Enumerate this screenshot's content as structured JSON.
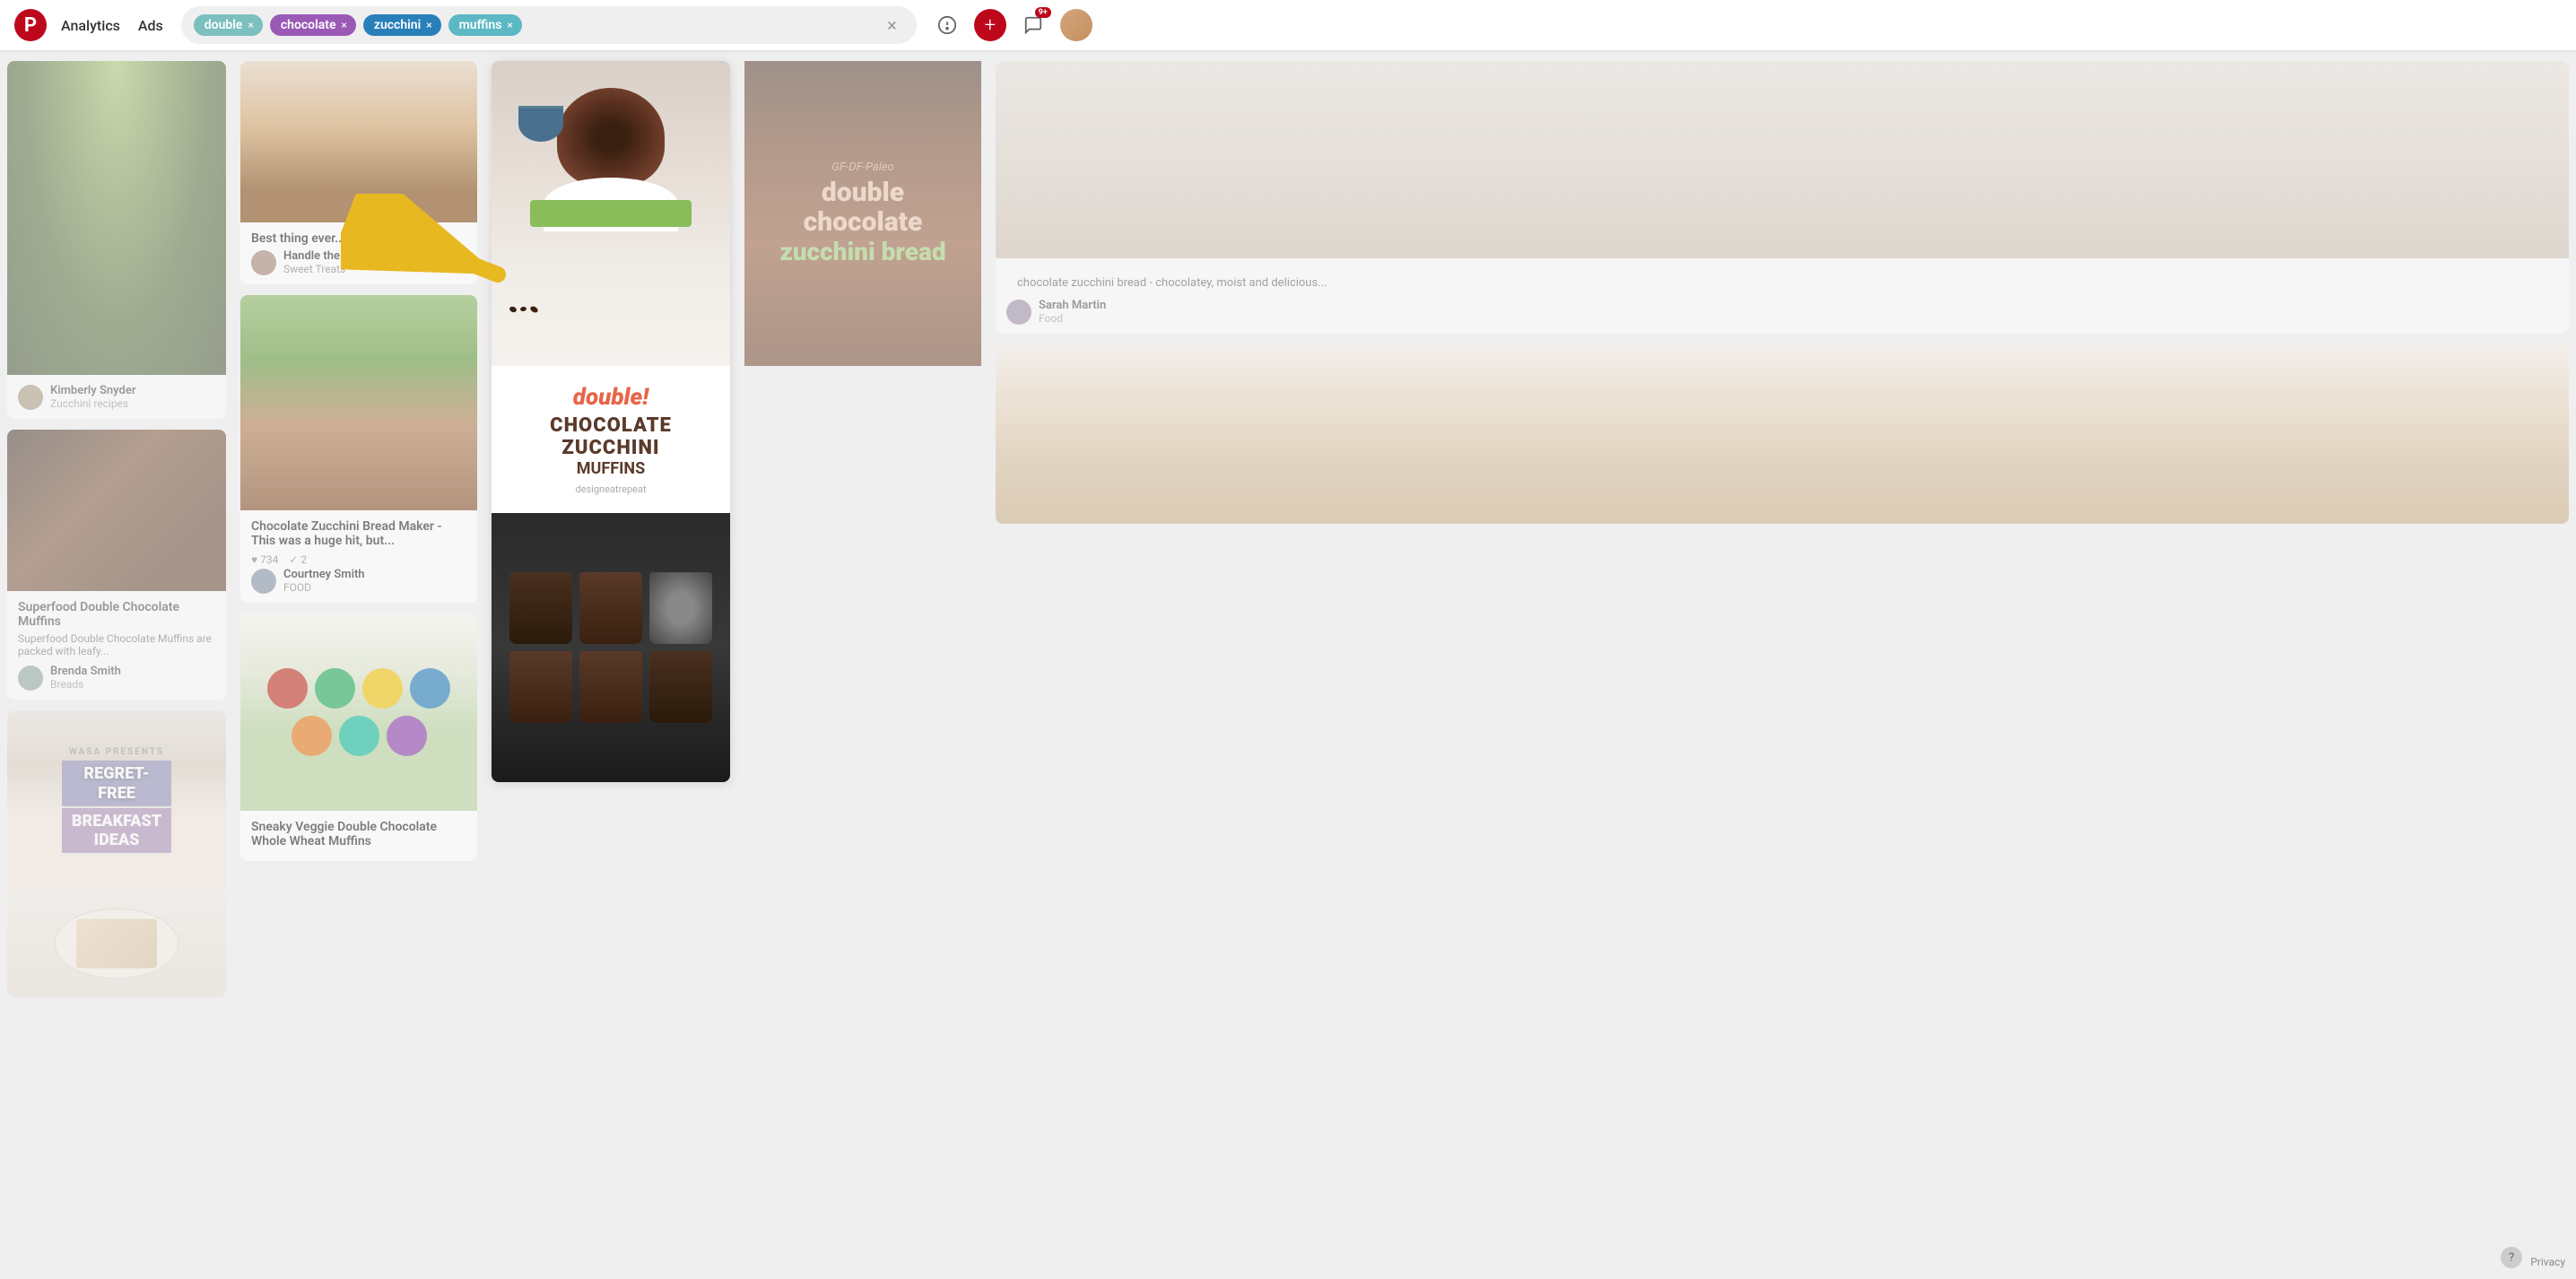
{
  "header": {
    "logo": "P",
    "nav": [
      "Analytics",
      "Ads"
    ],
    "search": {
      "tags": [
        {
          "label": "double",
          "color": "tag-double"
        },
        {
          "label": "chocolate",
          "color": "tag-chocolate"
        },
        {
          "label": "zucchini",
          "color": "tag-zucchini"
        },
        {
          "label": "muffins",
          "color": "tag-muffins"
        }
      ],
      "clear_label": "×"
    },
    "icons": {
      "news": "◎",
      "add": "+",
      "notifications": "✉",
      "badge": "9+"
    }
  },
  "col1": {
    "card1": {
      "user_name": "Kimberly Snyder",
      "user_board": "Zucchini recipes"
    },
    "card2": {
      "title": "Superfood Double Chocolate Muffins",
      "desc": "Superfood Double Chocolate Muffins are packed with leafy...",
      "user_name": "Brenda Smith",
      "user_board": "Breads"
    },
    "card3": {
      "title": "REGRET-FREE BREAKFAST IDEAS",
      "subtitle": "WASA PRESENTS"
    }
  },
  "col2": {
    "card1": {
      "title": "Best thing ever...",
      "user_name": "Handle the Heat | Te...",
      "user_board": "Sweet Treats"
    },
    "card2": {
      "title": "Chocolate Zucchini Bread Maker - This was a huge hit, but...",
      "stats_saves": "734",
      "stats_tries": "2",
      "user_name": "Courtney Smith",
      "user_board": "FOOD"
    },
    "card3": {
      "title": "Sneaky Veggie Double Chocolate Whole Wheat Muffins"
    }
  },
  "col_center": {
    "card": {
      "tag": "double!",
      "title": "CHOCOLATE",
      "subtitle": "ZUCCHINI",
      "item": "MUFFINS",
      "brand": "designeatrepeat"
    }
  },
  "col3": {
    "card1": {
      "text_gf": "GF-DF-Paleo",
      "text_main": "double chocolate",
      "text_green": "zucchini bread"
    }
  },
  "col4": {
    "card1": {
      "desc": "chocolate zucchini bread - chocolatey, moist and delicious...",
      "user_name": "Sarah Martin",
      "user_board": "Food"
    }
  },
  "footer": {
    "help": "?",
    "privacy": "Privacy"
  }
}
